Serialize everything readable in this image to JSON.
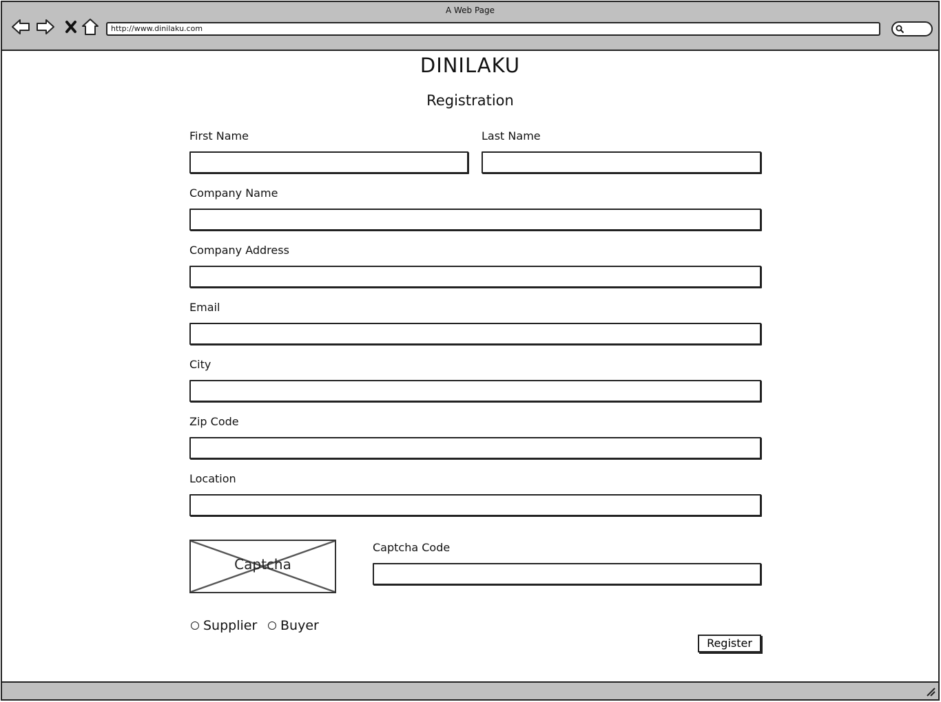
{
  "browser": {
    "title": "A Web Page",
    "url": "http://www.dinilaku.com",
    "icons": [
      "back-arrow-icon",
      "forward-arrow-icon",
      "stop-icon",
      "home-icon",
      "search-icon"
    ]
  },
  "page": {
    "brand": "DINILAKU",
    "heading": "Registration"
  },
  "form": {
    "first_name_label": "First Name",
    "last_name_label": "Last Name",
    "company_name_label": "Company Name",
    "company_address_label": "Company Address",
    "email_label": "Email",
    "city_label": "City",
    "zip_code_label": "Zip Code",
    "location_label": "Location",
    "captcha_image_label": "Captcha",
    "captcha_code_label": "Captcha Code",
    "role_options": [
      "Supplier",
      "Buyer"
    ],
    "register_label": "Register"
  }
}
